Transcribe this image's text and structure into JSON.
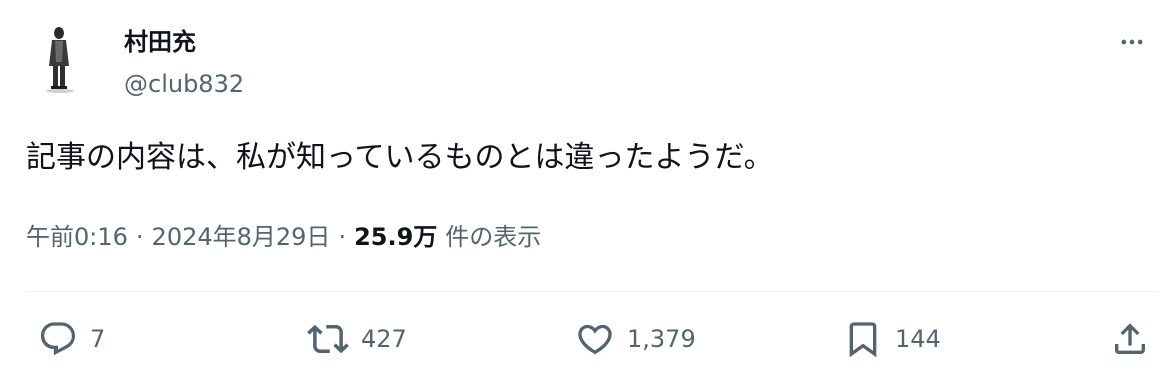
{
  "author": {
    "display_name": "村田充",
    "handle": "@club832"
  },
  "tweet": {
    "text": "記事の内容は、私が知っているものとは違ったようだ。",
    "time": "午前0:16",
    "separator": "·",
    "date": "2024年8月29日",
    "views_count": "25.9万",
    "views_label": "件の表示"
  },
  "actions": {
    "reply_count": "7",
    "retweet_count": "427",
    "like_count": "1,379",
    "bookmark_count": "144"
  },
  "icons": {
    "more": "more-horizontal-icon",
    "reply": "reply-icon",
    "retweet": "retweet-icon",
    "like": "heart-icon",
    "bookmark": "bookmark-icon",
    "share": "share-icon"
  },
  "colors": {
    "text_primary": "#0f1419",
    "text_secondary": "#536471",
    "divider": "#eff3f4"
  }
}
